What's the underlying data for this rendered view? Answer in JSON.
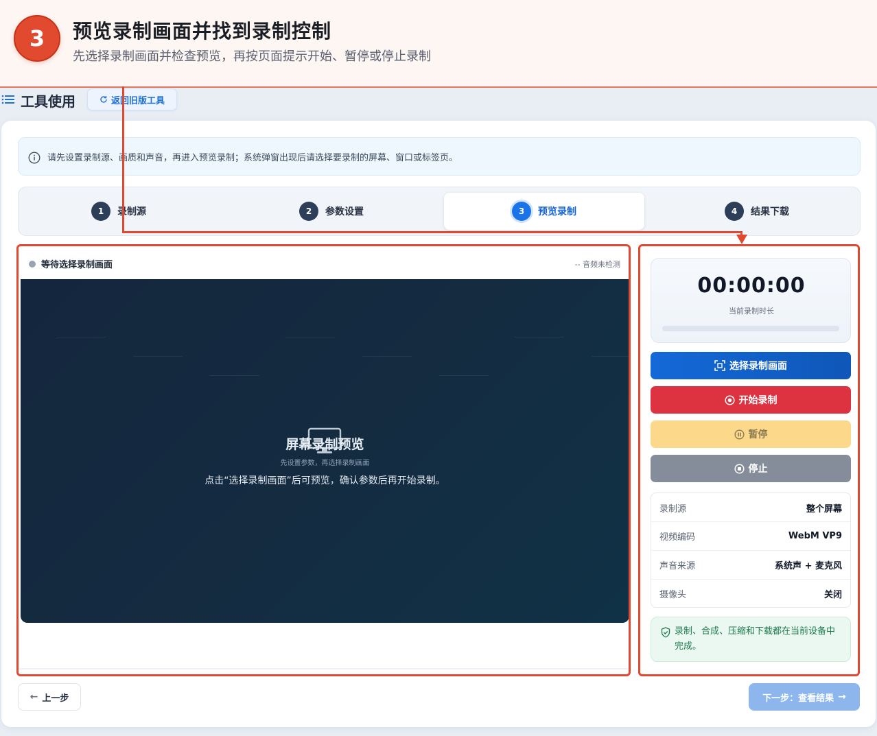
{
  "banner": {
    "step_number": "3",
    "title": "预览录制画面并找到录制控制",
    "subtitle": "先选择录制画面并检查预览，再按页面提示开始、暂停或停止录制"
  },
  "header": {
    "title": "工具使用",
    "back_old_label": "返回旧版工具"
  },
  "notice": {
    "text": "请先设置录制源、画质和声音，再进入预览录制；系统弹窗出现后请选择要录制的屏幕、窗口或标签页。"
  },
  "steps": [
    {
      "num": "1",
      "label": "录制源",
      "active": false
    },
    {
      "num": "2",
      "label": "参数设置",
      "active": false
    },
    {
      "num": "3",
      "label": "预览录制",
      "active": true
    },
    {
      "num": "4",
      "label": "结果下载",
      "active": false
    }
  ],
  "preview": {
    "status": "等待选择录制画面",
    "audio_status": "--  音频未检测",
    "title": "屏幕录制预览",
    "subtitle": "先设置参数，再选择录制画面",
    "hint": "点击“选择录制画面”后可预览，确认参数后再开始录制。"
  },
  "side": {
    "timer": "00:00:00",
    "timer_label": "当前录制时长",
    "progress": 0,
    "buttons": {
      "select": "选择录制画面",
      "start": "开始录制",
      "pause": "暂停",
      "stop": "停止"
    },
    "info": [
      {
        "key": "录制源",
        "value": "整个屏幕"
      },
      {
        "key": "视频编码",
        "value": "WebM VP9"
      },
      {
        "key": "声音来源",
        "value": "系统声 + 麦克风"
      },
      {
        "key": "摄像头",
        "value": "关闭"
      }
    ],
    "safe_note": "录制、合成、压缩和下载都在当前设备中完成。"
  },
  "footer": {
    "prev_label": "上一步",
    "next_label": "下一步：查看结果"
  },
  "colors": {
    "accent": "#1a73e8",
    "annotation": "#e0482f",
    "start_red": "#dd3340",
    "pause_yellow": "#fcd98a",
    "stop_gray": "#848d99"
  }
}
